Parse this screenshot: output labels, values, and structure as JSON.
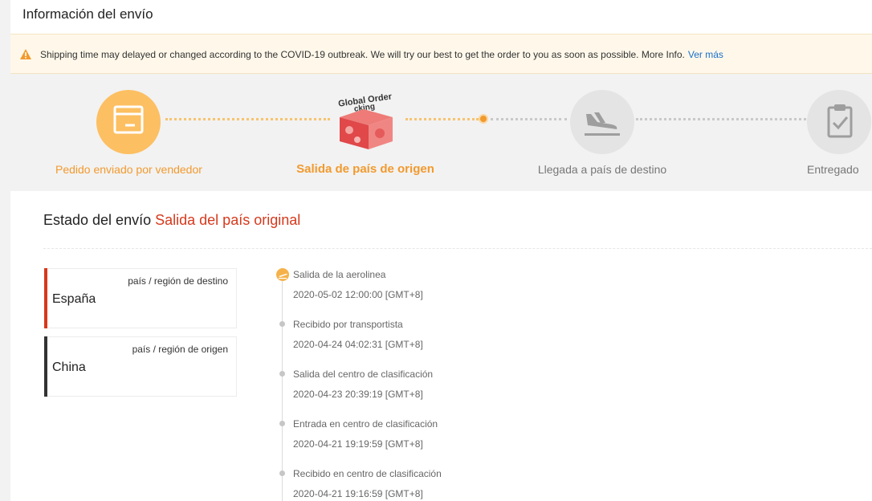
{
  "header": {
    "title": "Información del envío"
  },
  "notice": {
    "icon": "warning-icon",
    "text": "Shipping time may delayed or changed according to the COVID-19 outbreak. We will try our best to get the order to you as soon as possible. More Info.",
    "link": "Ver más"
  },
  "progress": {
    "steps": [
      {
        "label": "Pedido enviado por vendedor",
        "icon": "package-icon",
        "state": "done"
      },
      {
        "label": "Salida de país de origen",
        "icon": "global-order-tracking-box-icon",
        "state": "current",
        "logo_text_1": "Global Order",
        "logo_text_2": "cking"
      },
      {
        "label": "Llegada a país de destino",
        "icon": "plane-landing-icon",
        "state": "pending"
      },
      {
        "label": "Entregado",
        "icon": "clipboard-check-icon",
        "state": "pending"
      }
    ],
    "colors": {
      "active": "#f29a2e",
      "done_circle": "#fcbf62",
      "pending_circle": "#e4e4e4",
      "pending_text": "#777777"
    }
  },
  "status": {
    "label": "Estado del envío",
    "value": "Salida del país original",
    "value_color": "#d6391c"
  },
  "locations": [
    {
      "caption": "país / región de destino",
      "value": "España",
      "bar_color": "#d6391c"
    },
    {
      "caption": "país / región de origen",
      "value": "China",
      "bar_color": "#333333"
    }
  ],
  "timeline": [
    {
      "event": "Salida de la aerolinea",
      "time": "2020-05-02 12:00:00 [GMT+8]",
      "icon": "plane-takeoff-icon"
    },
    {
      "event": "Recibido por transportista",
      "time": "2020-04-24 04:02:31 [GMT+8]"
    },
    {
      "event": "Salida del centro de clasificación",
      "time": "2020-04-23 20:39:19 [GMT+8]"
    },
    {
      "event": "Entrada en centro de clasificación",
      "time": "2020-04-21 19:19:59 [GMT+8]"
    },
    {
      "event": "Recibido en centro de clasificación",
      "time": "2020-04-21 19:16:59 [GMT+8]"
    }
  ]
}
